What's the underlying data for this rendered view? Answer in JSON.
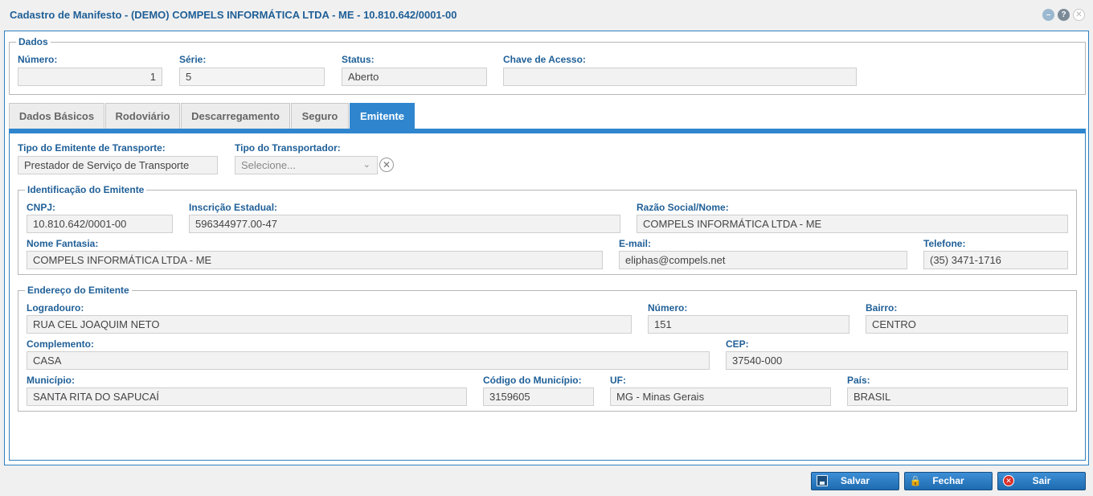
{
  "window": {
    "title": "Cadastro de Manifesto - (DEMO) COMPELS INFORMÁTICA LTDA - ME - 10.810.642/0001-00",
    "icons": [
      "minimize-icon",
      "help-icon",
      "close-icon"
    ]
  },
  "dados": {
    "legend": "Dados",
    "numero_label": "Número:",
    "numero_value": "1",
    "serie_label": "Série:",
    "serie_value": "5",
    "status_label": "Status:",
    "status_value": "Aberto",
    "chave_label": "Chave de Acesso:",
    "chave_value": ""
  },
  "tabs": [
    {
      "label": "Dados Básicos",
      "active": false
    },
    {
      "label": "Rodoviário",
      "active": false
    },
    {
      "label": "Descarregamento",
      "active": false
    },
    {
      "label": "Seguro",
      "active": false
    },
    {
      "label": "Emitente",
      "active": true
    }
  ],
  "emitente": {
    "tipo_emitente_label": "Tipo do Emitente de Transporte:",
    "tipo_emitente_value": "Prestador de Serviço de Transporte",
    "tipo_transportador_label": "Tipo do Transportador:",
    "tipo_transportador_placeholder": "Selecione..."
  },
  "identificacao": {
    "legend": "Identificação do Emitente",
    "cnpj_label": "CNPJ:",
    "cnpj_value": "10.810.642/0001-00",
    "ie_label": "Inscrição Estadual:",
    "ie_value": "596344977.00-47",
    "razao_label": "Razão Social/Nome:",
    "razao_value": "COMPELS INFORMÁTICA LTDA - ME",
    "fantasia_label": "Nome Fantasia:",
    "fantasia_value": "COMPELS INFORMÁTICA LTDA - ME",
    "email_label": "E-mail:",
    "email_value": "eliphas@compels.net",
    "telefone_label": "Telefone:",
    "telefone_value": "(35) 3471-1716"
  },
  "endereco": {
    "legend": "Endereço do Emitente",
    "logradouro_label": "Logradouro:",
    "logradouro_value": "RUA CEL JOAQUIM NETO",
    "numero_label": "Número:",
    "numero_value": "151",
    "bairro_label": "Bairro:",
    "bairro_value": "CENTRO",
    "complemento_label": "Complemento:",
    "complemento_value": "CASA",
    "cep_label": "CEP:",
    "cep_value": "37540-000",
    "municipio_label": "Município:",
    "municipio_value": "SANTA RITA DO SAPUCAÍ",
    "codmun_label": "Código do Município:",
    "codmun_value": "3159605",
    "uf_label": "UF:",
    "uf_value": "MG - Minas Gerais",
    "pais_label": "País:",
    "pais_value": "BRASIL"
  },
  "buttons": {
    "salvar": "Salvar",
    "fechar": "Fechar",
    "sair": "Sair"
  },
  "colors": {
    "accent": "#2f86cf",
    "label": "#1f5f97"
  }
}
